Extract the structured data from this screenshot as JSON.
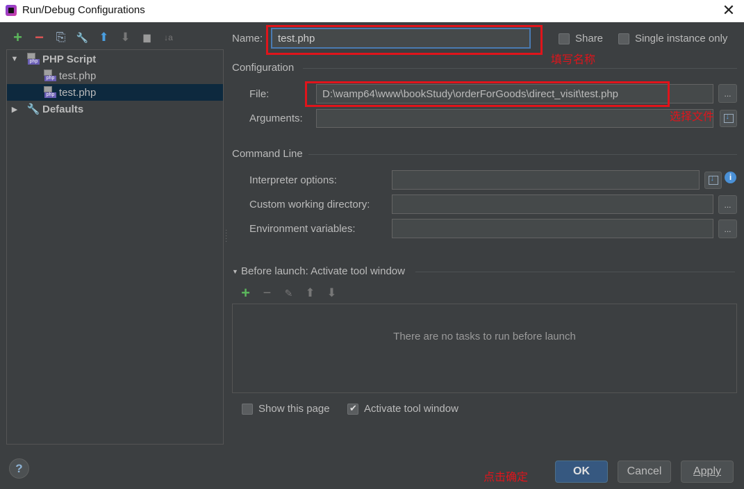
{
  "window": {
    "title": "Run/Debug Configurations",
    "close_glyph": "✕"
  },
  "left_toolbar": {
    "buttons": [
      {
        "name": "add",
        "glyph": "+"
      },
      {
        "name": "remove",
        "glyph": "−"
      },
      {
        "name": "copy",
        "glyph": "⎘"
      },
      {
        "name": "edit-defaults",
        "glyph": "🔧"
      },
      {
        "name": "move-up",
        "glyph": "⬆"
      },
      {
        "name": "move-down",
        "glyph": "⬇"
      },
      {
        "name": "folder",
        "glyph": "▆"
      },
      {
        "name": "sort",
        "glyph": "↓a"
      }
    ]
  },
  "tree": {
    "php_script": "PHP Script",
    "item1": "test.php",
    "item2": "test.php",
    "defaults": "Defaults"
  },
  "form": {
    "name_label": "Name:",
    "name_value": "test.php",
    "share_label": "Share",
    "single_instance_label": "Single instance only",
    "configuration_header": "Configuration",
    "file_label": "File:",
    "file_value": "D:\\wamp64\\www\\bookStudy\\orderForGoods\\direct_visit\\test.php",
    "arguments_label": "Arguments:",
    "command_line_header": "Command Line",
    "interpreter_label": "Interpreter options:",
    "cwd_label": "Custom working directory:",
    "env_label": "Environment variables:",
    "before_launch_header": "Before launch: Activate tool window",
    "no_tasks": "There are no tasks to run before launch",
    "show_page_label": "Show this page",
    "activate_tool_label": "Activate tool window",
    "dots": "..."
  },
  "annotations": {
    "fill_name": "填写名称",
    "choose_file": "选择文件",
    "click_ok": "点击确定"
  },
  "buttons": {
    "ok": "OK",
    "cancel": "Cancel",
    "apply": "Apply",
    "help": "?"
  },
  "colors": {
    "selection": "#0d293e",
    "annotation_red": "#e0141b",
    "ok_button": "#365880"
  }
}
